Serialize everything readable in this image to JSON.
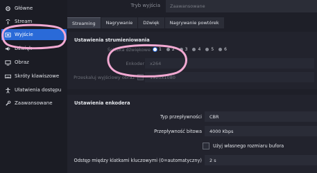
{
  "sidebar": {
    "items": [
      {
        "label": "Główne",
        "icon": "gear-icon"
      },
      {
        "label": "Stream",
        "icon": "broadcast-icon"
      },
      {
        "label": "Wyjście",
        "icon": "output-icon"
      },
      {
        "label": "Dźwięk",
        "icon": "speaker-icon"
      },
      {
        "label": "Obraz",
        "icon": "monitor-icon"
      },
      {
        "label": "Skróty klawiszowe",
        "icon": "keyboard-icon"
      },
      {
        "label": "Ułatwienia dostępu",
        "icon": "accessibility-icon"
      },
      {
        "label": "Zaawansowane",
        "icon": "wrench-icon"
      }
    ],
    "active_index": 2
  },
  "output_mode": {
    "label": "Tryb wyjścia",
    "value": "Zaawansowane"
  },
  "tabs": [
    "Streaming",
    "Nagrywanie",
    "Dźwięk",
    "Nagrywanie powtórek"
  ],
  "streaming": {
    "section_title": "Ustawienia strumieniowania",
    "audio_track_label": "Ścieżka dźwiękowe",
    "audio_tracks": [
      "1",
      "2",
      "3",
      "4",
      "5",
      "6"
    ],
    "audio_track_selected": "1",
    "encoder_label": "Enkoder",
    "encoder_value": "x264",
    "rescale_label": "Przeskaluj wyjściowy obraz",
    "rescale_value": "1920x1080"
  },
  "encoder_settings": {
    "section_title": "Ustawienia enkodera",
    "rate_control_label": "Typ przepływności",
    "rate_control_value": "CBR",
    "bitrate_label": "Przepływność bitowa",
    "bitrate_value": "4000 Kbps",
    "custom_buffer_label": "Użyj własnego rozmiaru bufora",
    "keyframe_label": "Odstęp między klatkami kluczowymi (0=automatyczny)",
    "keyframe_value": "2 s"
  },
  "colors": {
    "accent": "#2a6ad8",
    "annotation": "#f2a9d2"
  }
}
